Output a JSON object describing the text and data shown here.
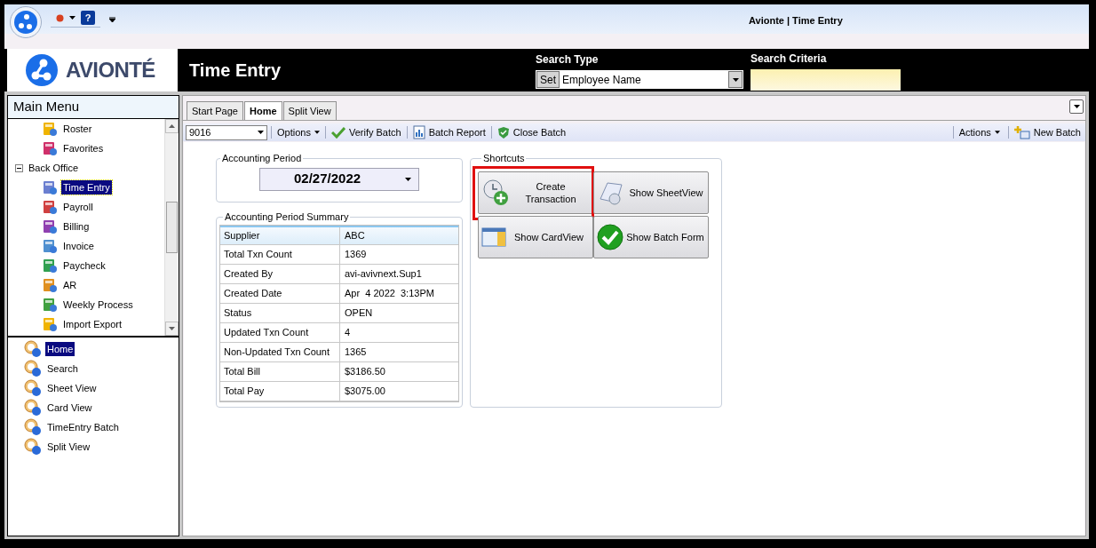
{
  "window": {
    "title": "Avionte | Time Entry"
  },
  "quick_access": {
    "help": "?"
  },
  "header": {
    "logo_text": "AVIONTÉ",
    "page_title": "Time Entry",
    "search_type_label": "Search Type",
    "set_button": "Set",
    "search_type_value": "Employee Name",
    "search_criteria_label": "Search Criteria"
  },
  "main_menu": {
    "title": "Main Menu",
    "items": [
      {
        "label": "Roster",
        "selected": false
      },
      {
        "label": "Favorites",
        "selected": false
      },
      {
        "label": "Back Office",
        "expanded": true,
        "selected": false,
        "children": [
          {
            "label": "Time Entry",
            "selected": true
          },
          {
            "label": "Payroll",
            "selected": false
          },
          {
            "label": "Billing",
            "selected": false
          },
          {
            "label": "Invoice",
            "selected": false
          },
          {
            "label": "Paycheck",
            "selected": false
          },
          {
            "label": "AR",
            "selected": false
          },
          {
            "label": "Weekly Process",
            "selected": false
          },
          {
            "label": "Import Export",
            "selected": false
          }
        ]
      }
    ]
  },
  "views": [
    {
      "label": "Home",
      "selected": true
    },
    {
      "label": "Search",
      "selected": false
    },
    {
      "label": "Sheet View",
      "selected": false
    },
    {
      "label": "Card View",
      "selected": false
    },
    {
      "label": "TimeEntry Batch",
      "selected": false
    },
    {
      "label": "Split View",
      "selected": false
    }
  ],
  "tabs": [
    {
      "label": "Start Page",
      "selected": false
    },
    {
      "label": "Home",
      "selected": true
    },
    {
      "label": "Split View",
      "selected": false
    }
  ],
  "toolbar": {
    "batch": "9016",
    "left": [
      {
        "label": "Options",
        "kind": "menu"
      },
      {
        "label": "Verify Batch",
        "kind": "verify"
      },
      {
        "label": "Batch Report",
        "kind": "report"
      },
      {
        "label": "Close Batch",
        "kind": "close"
      }
    ],
    "right": [
      {
        "label": "Actions",
        "kind": "menu"
      },
      {
        "label": "New Batch",
        "kind": "new"
      }
    ]
  },
  "accounting_period": {
    "title": "Accounting Period",
    "date": "02/27/2022"
  },
  "summary": {
    "title": "Accounting Period Summary",
    "rows": [
      {
        "label": "Supplier",
        "value": "ABC"
      },
      {
        "label": "Total Txn Count",
        "value": "1369"
      },
      {
        "label": "Created By",
        "value": "avi-avivnext.Sup1"
      },
      {
        "label": "Created Date",
        "value": "Apr  4 2022  3:13PM"
      },
      {
        "label": "Status",
        "value": "OPEN"
      },
      {
        "label": "Updated Txn Count",
        "value": "4"
      },
      {
        "label": "Non-Updated Txn Count",
        "value": "1365"
      },
      {
        "label": "Total Bill",
        "value": "$3186.50"
      },
      {
        "label": "Total Pay",
        "value": "$3075.00"
      }
    ]
  },
  "shortcuts": {
    "title": "Shortcuts",
    "buttons": [
      {
        "label": "Create Transaction",
        "kind": "create",
        "highlighted": true
      },
      {
        "label": "Show SheetView",
        "kind": "sheet",
        "highlighted": false
      },
      {
        "label": "Show CardView",
        "kind": "card",
        "highlighted": false
      },
      {
        "label": "Show Batch Form",
        "kind": "form",
        "highlighted": false
      }
    ]
  }
}
